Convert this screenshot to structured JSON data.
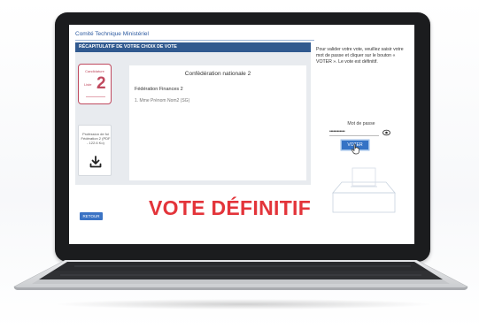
{
  "app": {
    "title": "Comité Technique Ministériel"
  },
  "section": {
    "title": "RÉCAPITULATIF DE VOTRE CHOIX DE VOTE"
  },
  "candidature": {
    "label": "Candidature",
    "list_label": "Liste",
    "number": "2"
  },
  "profession": {
    "text": "Profession de foi Fédération 2 (PDF - 122.6 Ko)",
    "icon": "download-icon"
  },
  "vote": {
    "organization": "Confédération nationale 2",
    "federation": "Fédération Finances 2",
    "candidate": "1. Mme Prénom Nom2 (SG)"
  },
  "buttons": {
    "retour": "RETOUR",
    "voter": "VOTER"
  },
  "instructions": {
    "text": "Pour valider votre vote, veuillez saisir votre mot de passe et cliquer sur le bouton « VOTER ». Le vote est définitif."
  },
  "password": {
    "label": "Mot de passe",
    "masked_value": "••••••••••••"
  },
  "headline": {
    "text": "VOTE DÉFINITIF"
  },
  "colors": {
    "primary_blue": "#30598f",
    "button_blue": "#3573c5",
    "headline_red": "#e3343a",
    "candidate_red": "#c04a5f"
  }
}
